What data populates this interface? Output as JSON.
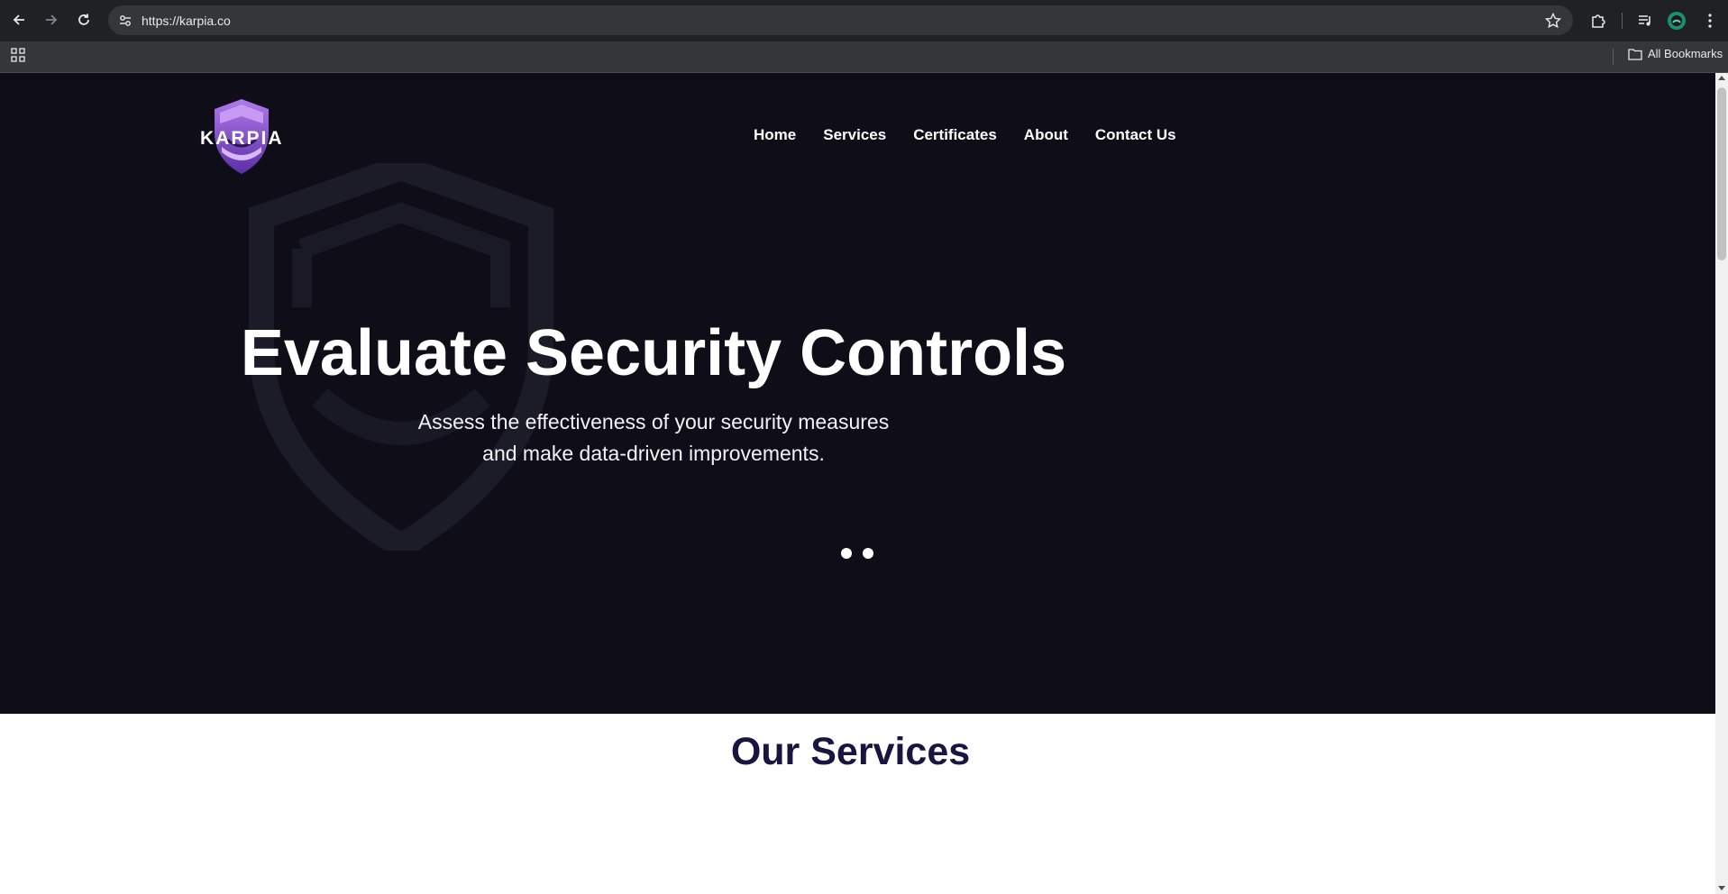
{
  "browser": {
    "url": "https://karpia.co",
    "bookmarks_label": "All Bookmarks",
    "icons": [
      "back-arrow-icon",
      "forward-arrow-icon",
      "reload-icon",
      "site-info-icon",
      "star-icon",
      "extensions-icon",
      "media-icon",
      "profile-icon",
      "menu-icon",
      "apps-grid-icon",
      "folder-icon"
    ]
  },
  "site": {
    "logo_text": "KARPIA",
    "nav": [
      "Home",
      "Services",
      "Certificates",
      "About",
      "Contact Us"
    ],
    "hero": {
      "title": "Evaluate Security Controls",
      "subtitle_line1": "Assess the effectiveness of your security measures",
      "subtitle_line2": "and make data-driven improvements.",
      "slide_count": 2
    },
    "services_heading": "Our Services"
  },
  "colors": {
    "hero_bg": "#0f0e18",
    "heading_dark": "#1a1440",
    "logo_purple": "#8b5fd6"
  }
}
